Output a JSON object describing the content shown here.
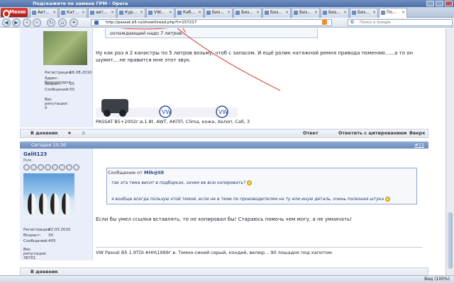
{
  "window": {
    "title": "Подскажите по замене ГРМ - Opera"
  },
  "menu": {
    "label": "Меню"
  },
  "tabs": [
    "Авт...",
    "Кат...",
    "авт...",
    "Кур...",
    "VW...",
    "Каб...",
    "Биз...",
    "Биз...",
    "Биз...",
    "Биз...",
    "Биз...",
    "Биз...",
    "По..."
  ],
  "address": {
    "url": "http://passat.b5.ru/showthread.php?t=157217"
  },
  "search": {
    "placeholder": "Поиск в Google"
  },
  "post1": {
    "quote_text": "охлаждающей надо 7 литров..",
    "body": "Ну как раз я 2 канистры по 5 литров возьму, чтоб с запасом. И ещё ролик натяжной ремня привода поменяю......а то он шумит....не нравится мне этот звук.",
    "reg_label": "Регистрация:",
    "reg_value": "16.08.2010",
    "addr_label": "Адрес:",
    "addr_value": "Красногорск",
    "age_label": "Возраст:",
    "age_value": "25",
    "msgs_label": "Сообщений:",
    "msgs_value": "50",
    "rep_label": "Вес репутации:",
    "rep_value": "0",
    "signature": "PASSAT B5+2002г.в,1.8t. AWT, АКПП, Clima, кожа, Хелоп, Саб, 3"
  },
  "postbar": {
    "diary": "В дневник",
    "reply": "Ответ",
    "reply_quote": "Ответить с цитированием",
    "top": "Вверх"
  },
  "post2": {
    "date": "Сегодня 15:30",
    "number": "#11",
    "username": "Galit123",
    "user_status": "Polo",
    "reg_label": "Регистрация:",
    "reg_value": "22.03.2010",
    "age_label": "Возраст:",
    "age_value": "30",
    "msgs_label": "Сообщений:",
    "msgs_value": "405",
    "rep_label": "Вес репутации:",
    "rep_value": "36701",
    "quote_header": "Сообщение от",
    "quote_author": "Mih@tit",
    "quote_line1": "так эта тема висит в подборках, зачем ее всю копировать?",
    "quote_line2": "я вообще всегда пользую этой темой, если не в теме по производителям на ту или иную деталь, очень полезная штука",
    "body": "Если бы умел ссылки вставлять, то не копировал бы! Стараюсь помочь чем могу, а не умничать!",
    "signature": "VW Passat B5 1.9TDI AHH\\1999г.в. Темно-синий серый, кондей, велюр... 90 лошадок под капотом."
  },
  "status": {
    "zoom": "Вид (100%)"
  },
  "colors": {
    "titlebar": "#4a6ea8",
    "post_header": "#6c8bbd",
    "annotation": "#d2352b"
  }
}
